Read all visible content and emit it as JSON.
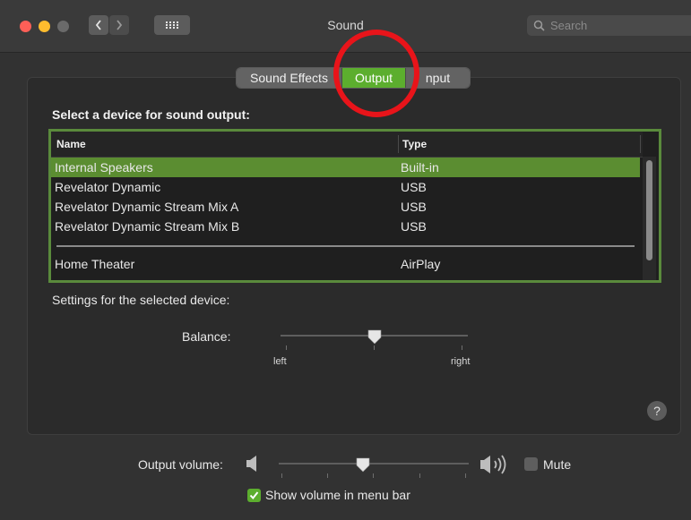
{
  "window": {
    "title": "Sound"
  },
  "toolbar": {
    "search_placeholder": "Search"
  },
  "tabs": [
    {
      "label": "Sound Effects",
      "selected": false
    },
    {
      "label": "Output",
      "selected": true
    },
    {
      "label": "nput",
      "selected": false
    }
  ],
  "device_section": {
    "heading": "Select a device for sound output:",
    "columns": [
      "Name",
      "Type"
    ],
    "rows": [
      {
        "name": "Internal Speakers",
        "type": "Built-in",
        "selected": true
      },
      {
        "name": "Revelator Dynamic",
        "type": "USB",
        "selected": false
      },
      {
        "name": "Revelator Dynamic Stream Mix A",
        "type": "USB",
        "selected": false
      },
      {
        "name": "Revelator Dynamic Stream Mix B",
        "type": "USB",
        "selected": false
      },
      {
        "name": "Home Theater",
        "type": "AirPlay",
        "selected": false
      }
    ]
  },
  "settings": {
    "heading": "Settings for the selected device:",
    "balance_label": "Balance:",
    "balance_left": "left",
    "balance_right": "right",
    "balance_value": 0.5
  },
  "help": {
    "label": "?"
  },
  "volume": {
    "label": "Output volume:",
    "value": 0.41,
    "mute_label": "Mute",
    "mute_checked": false
  },
  "menu_bar": {
    "label": "Show volume in menu bar",
    "checked": true
  },
  "colors": {
    "accent": "#5cae2e",
    "selection": "#5b8d31",
    "annotation": "#e8141a"
  },
  "icons": [
    "back-chevron-icon",
    "forward-chevron-icon",
    "grid-icon",
    "search-icon",
    "speaker-low-icon",
    "speaker-high-icon",
    "checkmark-icon",
    "help-icon"
  ]
}
